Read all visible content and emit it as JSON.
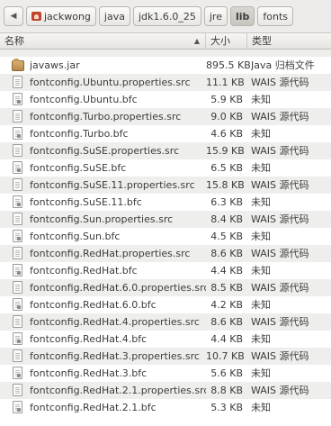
{
  "path_bar": {
    "back_label": "◀",
    "crumbs": [
      "jackwong",
      "java",
      "jdk1.6.0_25",
      "jre",
      "lib",
      "fonts"
    ]
  },
  "columns": {
    "name": "名称",
    "size": "大小",
    "type": "类型"
  },
  "rows": [
    {
      "name": "javaws.jar",
      "size": "895.5 KB",
      "type": "Java 归档文件",
      "icon": "jar-icon"
    },
    {
      "name": "fontconfig.Ubuntu.properties.src",
      "size": "11.1 KB",
      "type": "WAIS 源代码",
      "icon": "source-file-icon"
    },
    {
      "name": "fontconfig.Ubuntu.bfc",
      "size": "5.9 KB",
      "type": "未知",
      "icon": "unknown-file-icon"
    },
    {
      "name": "fontconfig.Turbo.properties.src",
      "size": "9.0 KB",
      "type": "WAIS 源代码",
      "icon": "source-file-icon"
    },
    {
      "name": "fontconfig.Turbo.bfc",
      "size": "4.6 KB",
      "type": "未知",
      "icon": "unknown-file-icon"
    },
    {
      "name": "fontconfig.SuSE.properties.src",
      "size": "15.9 KB",
      "type": "WAIS 源代码",
      "icon": "source-file-icon"
    },
    {
      "name": "fontconfig.SuSE.bfc",
      "size": "6.5 KB",
      "type": "未知",
      "icon": "unknown-file-icon"
    },
    {
      "name": "fontconfig.SuSE.11.properties.src",
      "size": "15.8 KB",
      "type": "WAIS 源代码",
      "icon": "source-file-icon"
    },
    {
      "name": "fontconfig.SuSE.11.bfc",
      "size": "6.3 KB",
      "type": "未知",
      "icon": "unknown-file-icon"
    },
    {
      "name": "fontconfig.Sun.properties.src",
      "size": "8.4 KB",
      "type": "WAIS 源代码",
      "icon": "source-file-icon"
    },
    {
      "name": "fontconfig.Sun.bfc",
      "size": "4.5 KB",
      "type": "未知",
      "icon": "unknown-file-icon"
    },
    {
      "name": "fontconfig.RedHat.properties.src",
      "size": "8.6 KB",
      "type": "WAIS 源代码",
      "icon": "source-file-icon"
    },
    {
      "name": "fontconfig.RedHat.bfc",
      "size": "4.4 KB",
      "type": "未知",
      "icon": "unknown-file-icon"
    },
    {
      "name": "fontconfig.RedHat.6.0.properties.src",
      "size": "8.5 KB",
      "type": "WAIS 源代码",
      "icon": "source-file-icon"
    },
    {
      "name": "fontconfig.RedHat.6.0.bfc",
      "size": "4.2 KB",
      "type": "未知",
      "icon": "unknown-file-icon"
    },
    {
      "name": "fontconfig.RedHat.4.properties.src",
      "size": "8.6 KB",
      "type": "WAIS 源代码",
      "icon": "source-file-icon"
    },
    {
      "name": "fontconfig.RedHat.4.bfc",
      "size": "4.4 KB",
      "type": "未知",
      "icon": "unknown-file-icon"
    },
    {
      "name": "fontconfig.RedHat.3.properties.src",
      "size": "10.7 KB",
      "type": "WAIS 源代码",
      "icon": "source-file-icon"
    },
    {
      "name": "fontconfig.RedHat.3.bfc",
      "size": "5.6 KB",
      "type": "未知",
      "icon": "unknown-file-icon"
    },
    {
      "name": "fontconfig.RedHat.2.1.properties.src",
      "size": "8.8 KB",
      "type": "WAIS 源代码",
      "icon": "source-file-icon"
    },
    {
      "name": "fontconfig.RedHat.2.1.bfc",
      "size": "5.3 KB",
      "type": "未知",
      "icon": "unknown-file-icon"
    }
  ]
}
